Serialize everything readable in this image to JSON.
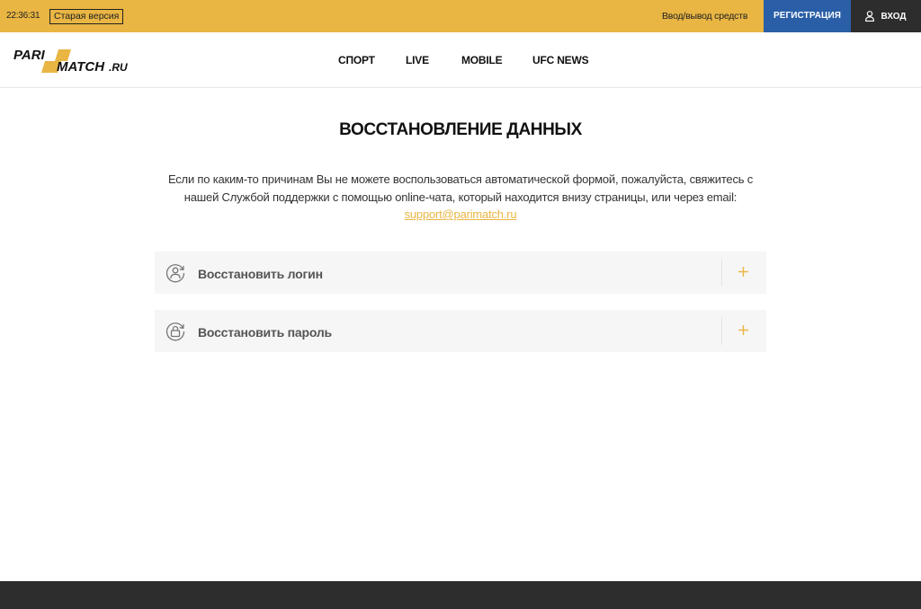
{
  "topbar": {
    "clock": "22:36:31",
    "old_version": "Старая версия",
    "deposit_link": "Ввод/вывод средств",
    "register": "РЕГИСТРАЦИЯ",
    "login": "ВХОД"
  },
  "logo": {
    "line1": "PARI",
    "line2": "MATCH",
    "suffix": ".RU"
  },
  "nav": {
    "items": [
      {
        "label": "СПОРТ"
      },
      {
        "label": "LIVE"
      },
      {
        "label": "MOBILE"
      },
      {
        "label": "UFC NEWS"
      }
    ]
  },
  "main": {
    "title": "ВОССТАНОВЛЕНИЕ ДАННЫХ",
    "intro_line1": "Если по каким-то причинам Вы не можете воспользоваться автоматической формой, пожалуйста, свяжитесь с",
    "intro_line2": "нашей Службой поддержки с помощью online-чата, который находится внизу страницы, или через email:",
    "support_email": "support@parimatch.ru",
    "accordions": [
      {
        "label": "Восстановить логин",
        "icon": "user-refresh-icon"
      },
      {
        "label": "Восстановить пароль",
        "icon": "lock-refresh-icon"
      }
    ]
  },
  "colors": {
    "accent": "#e9b543",
    "register_bg": "#2a5fa8",
    "dark": "#2d2d2d"
  }
}
